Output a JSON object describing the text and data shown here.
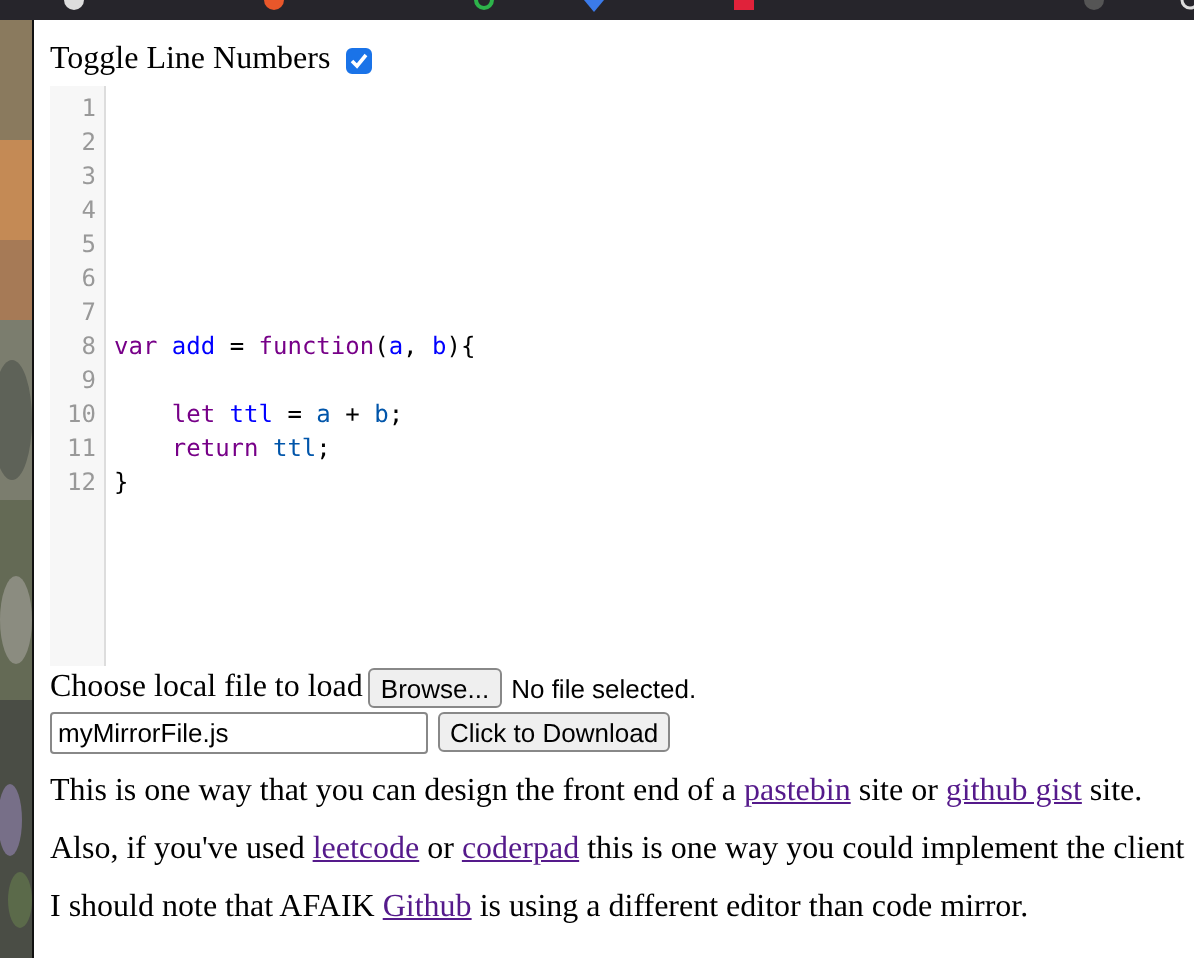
{
  "toggle": {
    "label": "Toggle Line Numbers",
    "checked": true
  },
  "editor": {
    "lines": [
      {
        "number": "1"
      },
      {
        "number": "2"
      },
      {
        "number": "3"
      },
      {
        "number": "4"
      },
      {
        "number": "5"
      },
      {
        "number": "6"
      },
      {
        "number": "7"
      },
      {
        "number": "8",
        "tokens": [
          {
            "text": "var ",
            "kind": "keyword"
          },
          {
            "text": "add",
            "kind": "def"
          },
          {
            "text": " = ",
            "kind": "plain"
          },
          {
            "text": "function",
            "kind": "keyword"
          },
          {
            "text": "(",
            "kind": "plain"
          },
          {
            "text": "a",
            "kind": "def"
          },
          {
            "text": ", ",
            "kind": "plain"
          },
          {
            "text": "b",
            "kind": "def"
          },
          {
            "text": "){",
            "kind": "plain"
          }
        ]
      },
      {
        "number": "9"
      },
      {
        "number": "10",
        "tokens": [
          {
            "text": "    let ",
            "kind": "keyword"
          },
          {
            "text": "ttl",
            "kind": "def"
          },
          {
            "text": " = ",
            "kind": "plain"
          },
          {
            "text": "a",
            "kind": "variable"
          },
          {
            "text": " + ",
            "kind": "plain"
          },
          {
            "text": "b",
            "kind": "variable"
          },
          {
            "text": ";",
            "kind": "plain"
          }
        ]
      },
      {
        "number": "11",
        "tokens": [
          {
            "text": "    return ",
            "kind": "keyword"
          },
          {
            "text": "ttl",
            "kind": "variable"
          },
          {
            "text": ";",
            "kind": "plain"
          }
        ]
      },
      {
        "number": "12",
        "tokens": [
          {
            "text": "}",
            "kind": "plain"
          }
        ]
      }
    ]
  },
  "load": {
    "label": "Choose local file to load",
    "button": "Browse...",
    "status": "No file selected."
  },
  "download": {
    "filename": "myMirrorFile.js",
    "button": "Click to Download"
  },
  "paragraphs": [
    [
      {
        "text": "This is one way that you can design the front end of a ",
        "kind": "text"
      },
      {
        "text": "pastebin",
        "kind": "link"
      },
      {
        "text": " site or ",
        "kind": "text"
      },
      {
        "text": "github gist",
        "kind": "link"
      },
      {
        "text": " site.",
        "kind": "text"
      }
    ],
    [
      {
        "text": "Also, if you've used ",
        "kind": "text"
      },
      {
        "text": "leetcode",
        "kind": "link"
      },
      {
        "text": " or ",
        "kind": "text"
      },
      {
        "text": "coderpad",
        "kind": "link"
      },
      {
        "text": " this is one way you could implement the client",
        "kind": "text"
      }
    ],
    [
      {
        "text": "I should note that AFAIK ",
        "kind": "text"
      },
      {
        "text": "Github",
        "kind": "link"
      },
      {
        "text": " is using a different editor than code mirror.",
        "kind": "text"
      }
    ]
  ]
}
